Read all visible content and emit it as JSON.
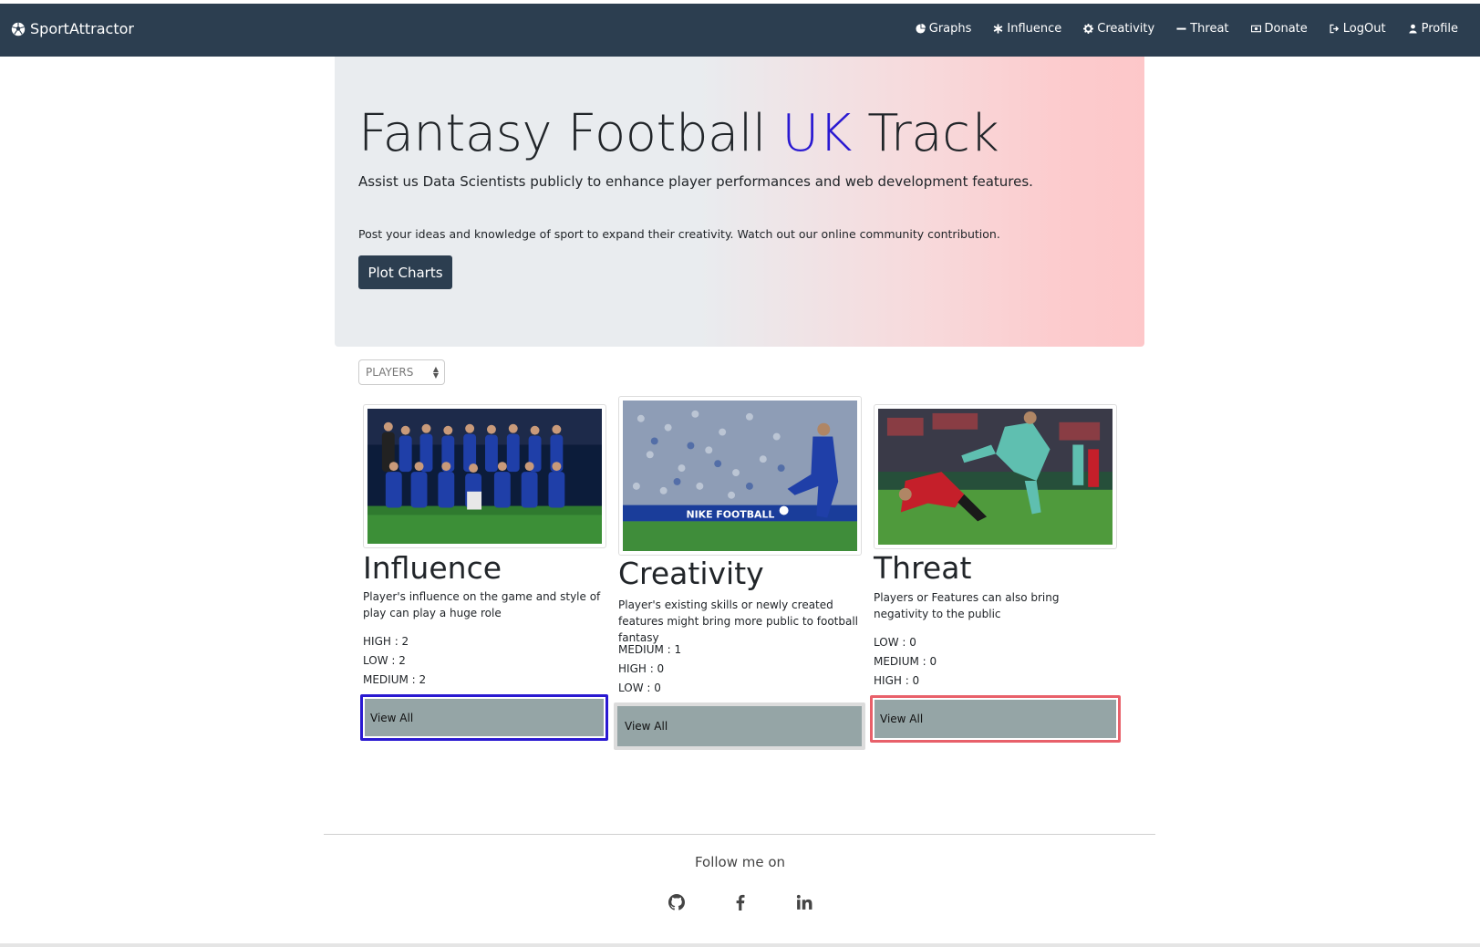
{
  "app": {
    "brand": "SportAttractor"
  },
  "nav": {
    "items": [
      {
        "label": "Graphs",
        "icon": "pie-chart-icon"
      },
      {
        "label": "Influence",
        "icon": "asterisk-icon"
      },
      {
        "label": "Creativity",
        "icon": "gear-icon"
      },
      {
        "label": "Threat",
        "icon": "minus-icon"
      },
      {
        "label": "Donate",
        "icon": "money-icon"
      },
      {
        "label": "LogOut",
        "icon": "sign-out-icon"
      },
      {
        "label": "Profile",
        "icon": "user-icon"
      }
    ]
  },
  "hero": {
    "title_pre": "Fantasy Football ",
    "title_accent": "UK",
    "title_post": " Track",
    "lead": "Assist us Data Scientists publicly to enhance player performances and web development features.",
    "text": "Post your ideas and knowledge of sport to expand their creativity. Watch out our online community contribution.",
    "button": "Plot Charts",
    "accent_color": "#2a19d1"
  },
  "filter": {
    "selected": "PLAYERS"
  },
  "cards": [
    {
      "title": "Influence",
      "description": "Player's influence on the game and style of play can play a huge role",
      "stats": [
        "HIGH : 2",
        "LOW : 2",
        "MEDIUM : 2"
      ],
      "button": "View All",
      "image": "team-photo-image",
      "outline_color": "#2a19d1"
    },
    {
      "title": "Creativity",
      "description": "Player's existing skills or newly created features might bring more public to football fantasy",
      "stats": [
        "MEDIUM : 1",
        "HIGH : 0",
        "LOW : 0"
      ],
      "button": "View All",
      "image": "player-kicking-image",
      "outline_color": "#dcdcdc"
    },
    {
      "title": "Threat",
      "description": "Players or Features can also bring negativity to the public",
      "stats": [
        "LOW : 0",
        "MEDIUM : 0",
        "HIGH : 0"
      ],
      "button": "View All",
      "image": "tackle-photo-image",
      "outline_color": "#e8606a"
    }
  ],
  "footer": {
    "follow": "Follow me on",
    "socials": [
      "github-icon",
      "facebook-icon",
      "linkedin-icon"
    ]
  }
}
